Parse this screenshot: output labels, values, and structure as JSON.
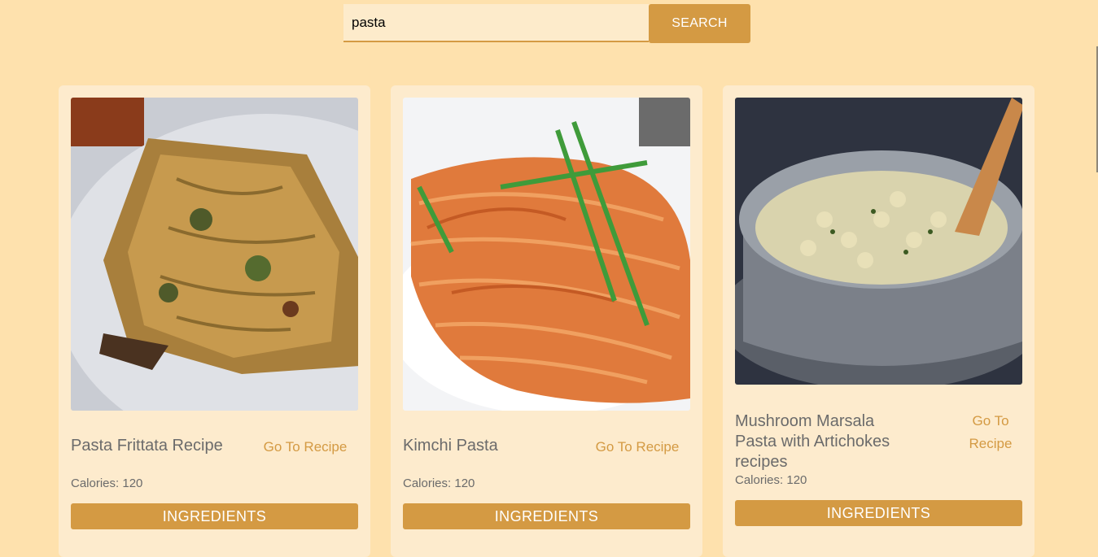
{
  "search": {
    "value": "pasta",
    "button_label": "SEARCH"
  },
  "recipes": [
    {
      "title": "Pasta Frittata Recipe",
      "link_label": "Go To Recipe",
      "calories": "Calories: 120",
      "ingredients_label": "INGREDIENTS"
    },
    {
      "title": "Kimchi Pasta",
      "link_label": "Go To Recipe",
      "calories": "Calories: 120",
      "ingredients_label": "INGREDIENTS"
    },
    {
      "title": "Mushroom Marsala Pasta with Artichokes recipes",
      "link_label": "Go To Recipe",
      "calories": "Calories: 120",
      "ingredients_label": "INGREDIENTS"
    }
  ],
  "colors": {
    "background": "#fee1ad",
    "card": "#fdebcd",
    "accent": "#d49a43",
    "text": "#6b6b6b"
  }
}
